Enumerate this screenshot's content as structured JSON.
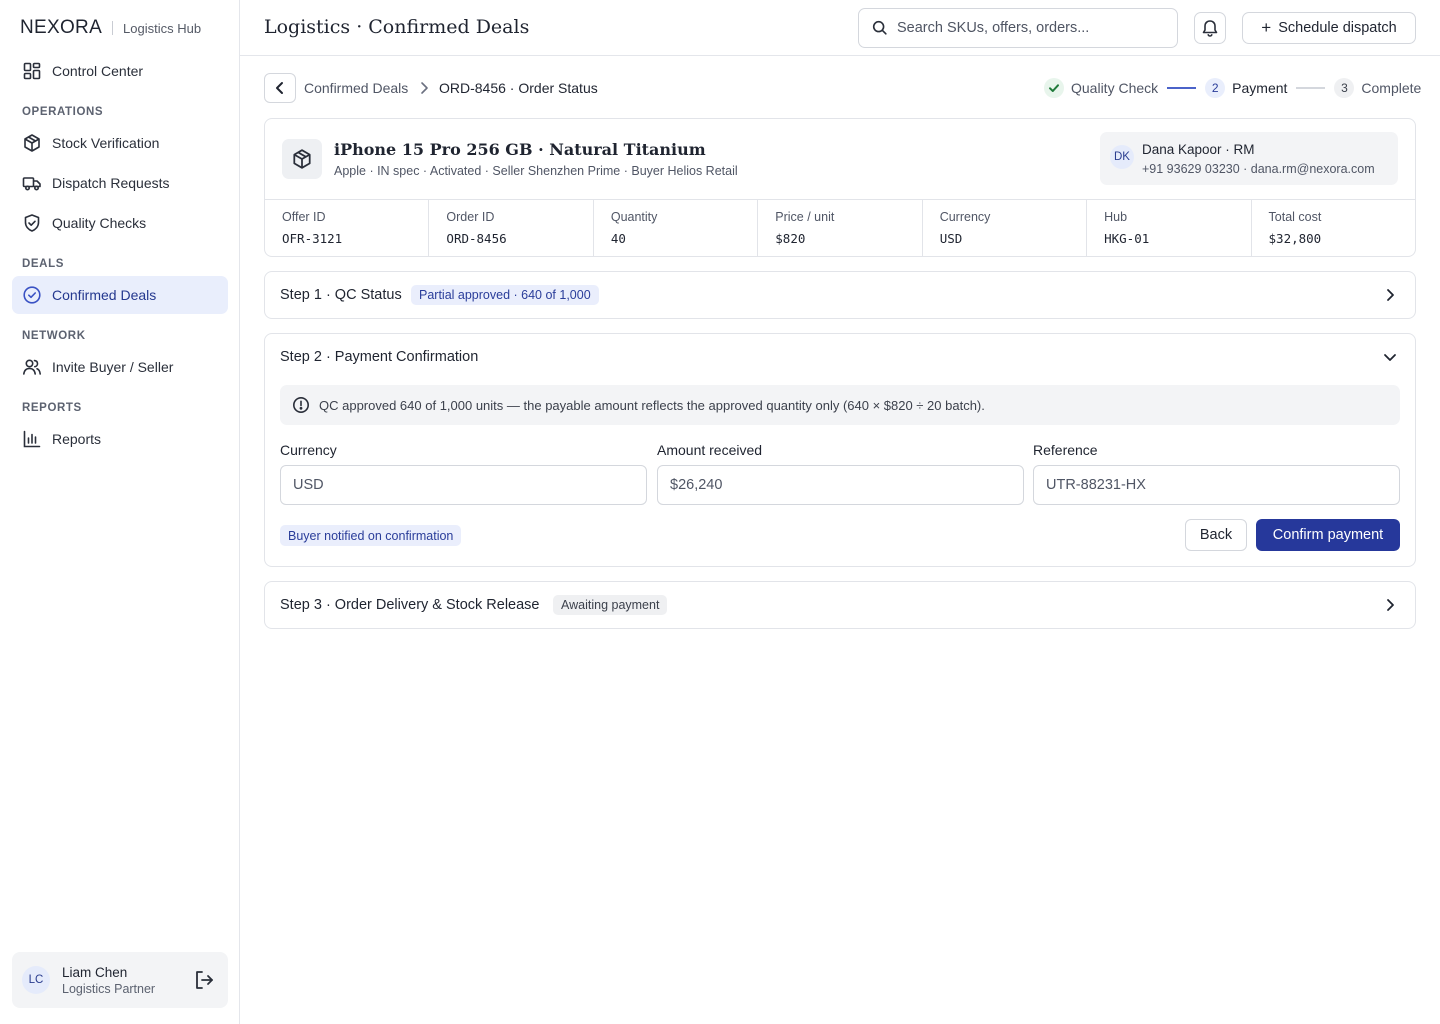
{
  "brand": {
    "name": "NEXORA",
    "subtitle": "Logistics Hub"
  },
  "sidebar": {
    "items": [
      {
        "label": "Control Center",
        "icon": "grid-icon"
      },
      {
        "label": "Stock Verification",
        "icon": "package-icon"
      },
      {
        "label": "Dispatch Requests",
        "icon": "truck-icon"
      },
      {
        "label": "Quality Checks",
        "icon": "shield-check-icon"
      },
      {
        "label": "Confirmed Deals",
        "icon": "check-circle-icon",
        "active": true
      },
      {
        "label": "Invite Buyer / Seller",
        "icon": "users-icon"
      },
      {
        "label": "Reports",
        "icon": "bar-chart-icon"
      }
    ],
    "sections": {
      "operations": "OPERATIONS",
      "deals": "DEALS",
      "network": "NETWORK",
      "reports": "REPORTS"
    },
    "user": {
      "initials": "LC",
      "name": "Liam Chen",
      "role": "Logistics Partner"
    }
  },
  "header": {
    "title": "Logistics · Confirmed Deals",
    "search_placeholder": "Search SKUs, offers, orders...",
    "schedule_label": "Schedule dispatch"
  },
  "breadcrumb": {
    "parent": "Confirmed Deals",
    "current": "ORD-8456 · Order Status"
  },
  "stepper": [
    {
      "label": "Quality Check",
      "state": "done"
    },
    {
      "number": "2",
      "label": "Payment",
      "state": "current"
    },
    {
      "number": "3",
      "label": "Complete",
      "state": "upcoming"
    }
  ],
  "product": {
    "title": "iPhone 15 Pro 256 GB · Natural Titanium",
    "meta": "Apple · IN spec · Activated · Seller Shenzhen Prime · Buyer Helios Retail",
    "rm": {
      "initials": "DK",
      "name": "Dana Kapoor · RM",
      "contact": "+91 93629 03230 · dana.rm@nexora.com"
    },
    "stats": [
      {
        "label": "Offer ID",
        "value": "OFR-3121"
      },
      {
        "label": "Order ID",
        "value": "ORD-8456"
      },
      {
        "label": "Quantity",
        "value": "40"
      },
      {
        "label": "Price / unit",
        "value": "$820"
      },
      {
        "label": "Currency",
        "value": "USD"
      },
      {
        "label": "Hub",
        "value": "HKG-01"
      },
      {
        "label": "Total cost",
        "value": "$32,800"
      }
    ]
  },
  "step1": {
    "title": "Step 1 · QC Status",
    "badge": "Partial approved · 640 of 1,000"
  },
  "step2": {
    "title": "Step 2 · Payment Confirmation",
    "info": "QC approved 640 of 1,000 units — the payable amount reflects the approved quantity only (640 × $820 ÷ 20 batch).",
    "fields": [
      {
        "label": "Currency",
        "value": "USD"
      },
      {
        "label": "Amount received",
        "value": "$26,240"
      },
      {
        "label": "Reference",
        "value": "UTR-88231-HX"
      }
    ],
    "notify_badge": "Buyer notified on confirmation",
    "back_label": "Back",
    "confirm_label": "Confirm payment"
  },
  "step3": {
    "title": "Step 3 · Order Delivery & Stock Release",
    "badge": "Awaiting payment"
  },
  "colors": {
    "accent": "#26389b",
    "active_nav_bg": "#e9eefc",
    "success": "#1f7a3a"
  }
}
